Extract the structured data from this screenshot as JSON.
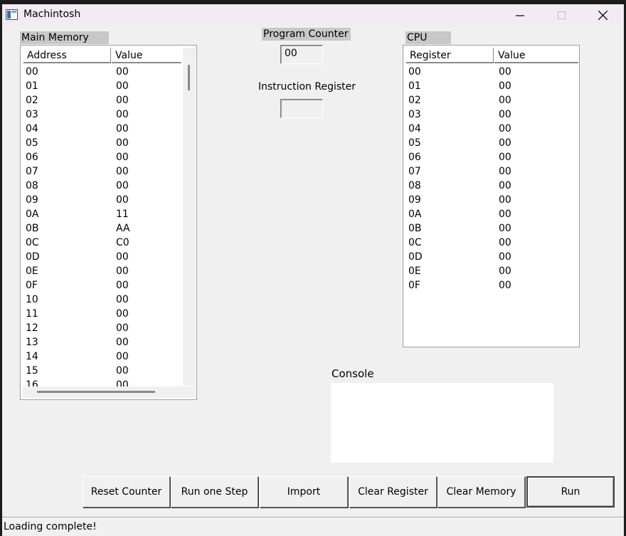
{
  "window": {
    "title": "Machintosh"
  },
  "memory": {
    "label": "Main Memory",
    "columns": [
      "Address",
      "Value"
    ],
    "rows": [
      [
        "00",
        "00"
      ],
      [
        "01",
        "00"
      ],
      [
        "02",
        "00"
      ],
      [
        "03",
        "00"
      ],
      [
        "04",
        "00"
      ],
      [
        "05",
        "00"
      ],
      [
        "06",
        "00"
      ],
      [
        "07",
        "00"
      ],
      [
        "08",
        "00"
      ],
      [
        "09",
        "00"
      ],
      [
        "0A",
        "11"
      ],
      [
        "0B",
        "AA"
      ],
      [
        "0C",
        "C0"
      ],
      [
        "0D",
        "00"
      ],
      [
        "0E",
        "00"
      ],
      [
        "0F",
        "00"
      ],
      [
        "10",
        "00"
      ],
      [
        "11",
        "00"
      ],
      [
        "12",
        "00"
      ],
      [
        "13",
        "00"
      ],
      [
        "14",
        "00"
      ],
      [
        "15",
        "00"
      ],
      [
        "16",
        "00"
      ]
    ]
  },
  "program_counter": {
    "label": "Program Counter",
    "value": "00"
  },
  "instruction_register": {
    "label": "Instruction Register",
    "value": ""
  },
  "cpu": {
    "label": "CPU",
    "columns": [
      "Register",
      "Value"
    ],
    "rows": [
      [
        "00",
        "00"
      ],
      [
        "01",
        "00"
      ],
      [
        "02",
        "00"
      ],
      [
        "03",
        "00"
      ],
      [
        "04",
        "00"
      ],
      [
        "05",
        "00"
      ],
      [
        "06",
        "00"
      ],
      [
        "07",
        "00"
      ],
      [
        "08",
        "00"
      ],
      [
        "09",
        "00"
      ],
      [
        "0A",
        "00"
      ],
      [
        "0B",
        "00"
      ],
      [
        "0C",
        "00"
      ],
      [
        "0D",
        "00"
      ],
      [
        "0E",
        "00"
      ],
      [
        "0F",
        "00"
      ]
    ]
  },
  "console": {
    "label": "Console",
    "text": ""
  },
  "buttons": {
    "reset": "Reset Counter",
    "step": "Run one Step",
    "import": "Import",
    "clear_register": "Clear Register",
    "clear_memory": "Clear Memory",
    "run": "Run"
  },
  "status": {
    "text": "Loading complete!"
  }
}
